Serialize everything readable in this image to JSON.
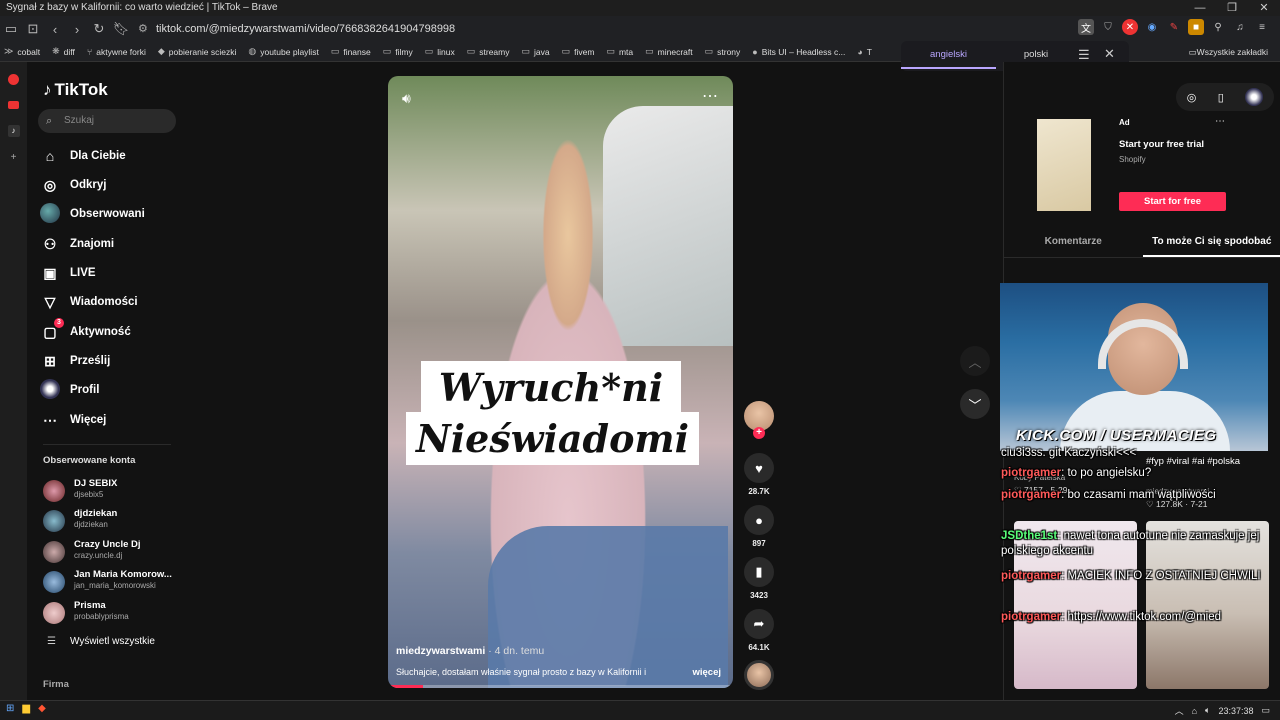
{
  "window": {
    "title": "Sygnał z bazy w Kalifornii: co warto wiedzieć | TikTok – Brave"
  },
  "browser": {
    "url": "tiktok.com/@miedzywarstwami/video/7668382641904798998",
    "bookmarks": [
      "cobalt",
      "diff",
      "aktywne forki",
      "pobieranie sciezki",
      "youtube playlist",
      "finanse",
      "filmy",
      "linux",
      "streamy",
      "java",
      "fivem",
      "mta",
      "minecraft",
      "strony",
      "Bits UI – Headless c...",
      "T"
    ],
    "bookmarks_end": "Wszystkie zakładki"
  },
  "translate_popup": {
    "tab_source": "angielski",
    "tab_target": "polski"
  },
  "sidebar": {
    "logo": "TikTok",
    "search_placeholder": "Szukaj",
    "menu": [
      "Dla Ciebie",
      "Odkryj",
      "Obserwowani",
      "Znajomi",
      "LIVE",
      "Wiadomości",
      "Aktywność",
      "Prześlij",
      "Profil",
      "Więcej"
    ],
    "activity_badge": "3",
    "followed_title": "Obserwowane konta",
    "accounts": [
      {
        "name": "DJ SEBIX",
        "handle": "djsebix5"
      },
      {
        "name": "djdziekan",
        "handle": "djdziekan"
      },
      {
        "name": "Crazy Uncle Dj",
        "handle": "crazy.uncle.dj"
      },
      {
        "name": "Jan Maria Komorow...",
        "handle": "jan_maria_komorowski"
      },
      {
        "name": "Prisma",
        "handle": "probablyprisma"
      }
    ],
    "see_all": "Wyświetl wszystkie",
    "footer": "Firma"
  },
  "video": {
    "overlay_line1": "Wyruch*ni",
    "overlay_line2": "Nieświadomi",
    "author": "miedzywarstwami",
    "posted": " · 4 dn. temu",
    "description": "Słuchajcie, dostałam właśnie sygnał prosto z bazy w Kalifornii i",
    "more": "więcej",
    "progress": 0.1
  },
  "actions": {
    "likes": "28.7K",
    "comments": "897",
    "saves": "3423",
    "shares": "64.1K"
  },
  "right_panel": {
    "ad": {
      "label": "Ad",
      "title": "Start your free trial",
      "brand": "Shopify",
      "cta": "Start for free"
    },
    "tabs": [
      "Komentarze",
      "To może Ci się spodobać"
    ]
  },
  "stream": {
    "overlay_tag": "KICK.COM / USERMACIEG",
    "chat": [
      {
        "user": "",
        "text": "ciu3i3ss. git  Kaczyński<<<"
      },
      {
        "user": "piotrgamer",
        "text": ": to po angielsku?"
      },
      {
        "user": "piotrgamer",
        "text": ": bo czasami mam wątpliwości"
      },
      {
        "user": "JSDthe1st",
        "text": ": nawet tona autotune nie zamaskuje jej polskiego akcentu"
      },
      {
        "user": "piotrgamer",
        "text": ": MACIEK INFO Z OSTATNIEJ CHWILI"
      },
      {
        "user": "piotrgamer",
        "text": ": https://www.tiktok.com/@mied"
      }
    ],
    "behind_text": [
      "Koby Patelska",
      "♡ 7157 · 5-29",
      "#fyp #viral #ai #polska",
      "miedzywarstwami",
      "♡ 127.8K · 7-21"
    ]
  },
  "taskbar": {
    "time": "23:37:38"
  },
  "colors": {
    "accent": "#fe2c55",
    "chat_user": "#ff5a5a",
    "chat_user2": "#5aff7a"
  }
}
